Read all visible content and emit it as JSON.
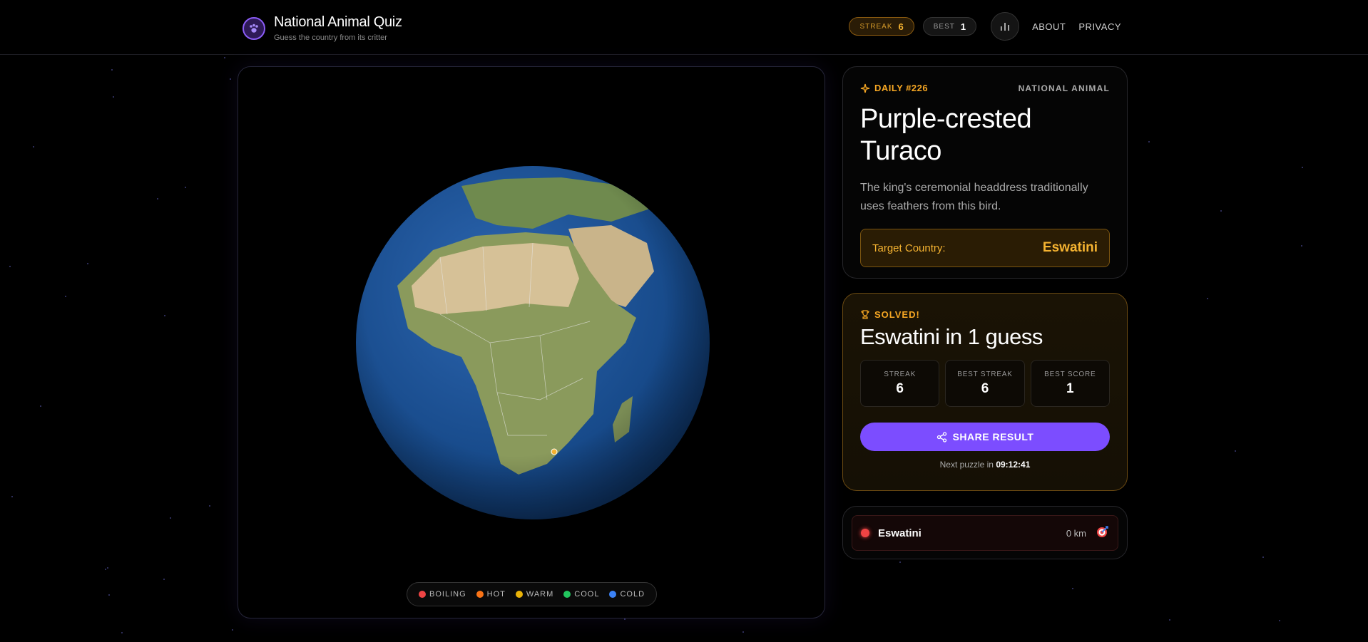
{
  "header": {
    "title": "National Animal Quiz",
    "subtitle": "Guess the country from its critter",
    "streak_label": "STREAK",
    "streak_value": "6",
    "best_label": "BEST",
    "best_value": "1",
    "nav": [
      "ABOUT",
      "PRIVACY"
    ]
  },
  "puzzle": {
    "daily": "DAILY #226",
    "kind": "NATIONAL ANIMAL",
    "animal": "Purple-crested Turaco",
    "hint": "The king's ceremonial headdress traditionally uses feathers from this bird.",
    "target_label": "Target Country:",
    "target_value": "Eswatini"
  },
  "result": {
    "status": "SOLVED!",
    "title": "Eswatini in 1 guess",
    "stats": [
      {
        "label": "STREAK",
        "value": "6"
      },
      {
        "label": "BEST STREAK",
        "value": "6"
      },
      {
        "label": "BEST SCORE",
        "value": "1"
      }
    ],
    "share_label": "SHARE RESULT",
    "next_prefix": "Next puzzle in",
    "next_time": "09:12:41"
  },
  "guesses": [
    {
      "country": "Eswatini",
      "distance": "0 km",
      "heat": "boiling"
    }
  ],
  "legend": [
    {
      "label": "BOILING",
      "color": "#ef4444"
    },
    {
      "label": "HOT",
      "color": "#f97316"
    },
    {
      "label": "WARM",
      "color": "#eab308"
    },
    {
      "label": "COOL",
      "color": "#22c55e"
    },
    {
      "label": "COLD",
      "color": "#3b82f6"
    }
  ],
  "colors": {
    "accent": "#7c4dff",
    "gold": "#f5b331",
    "boiling": "#ef4444"
  }
}
